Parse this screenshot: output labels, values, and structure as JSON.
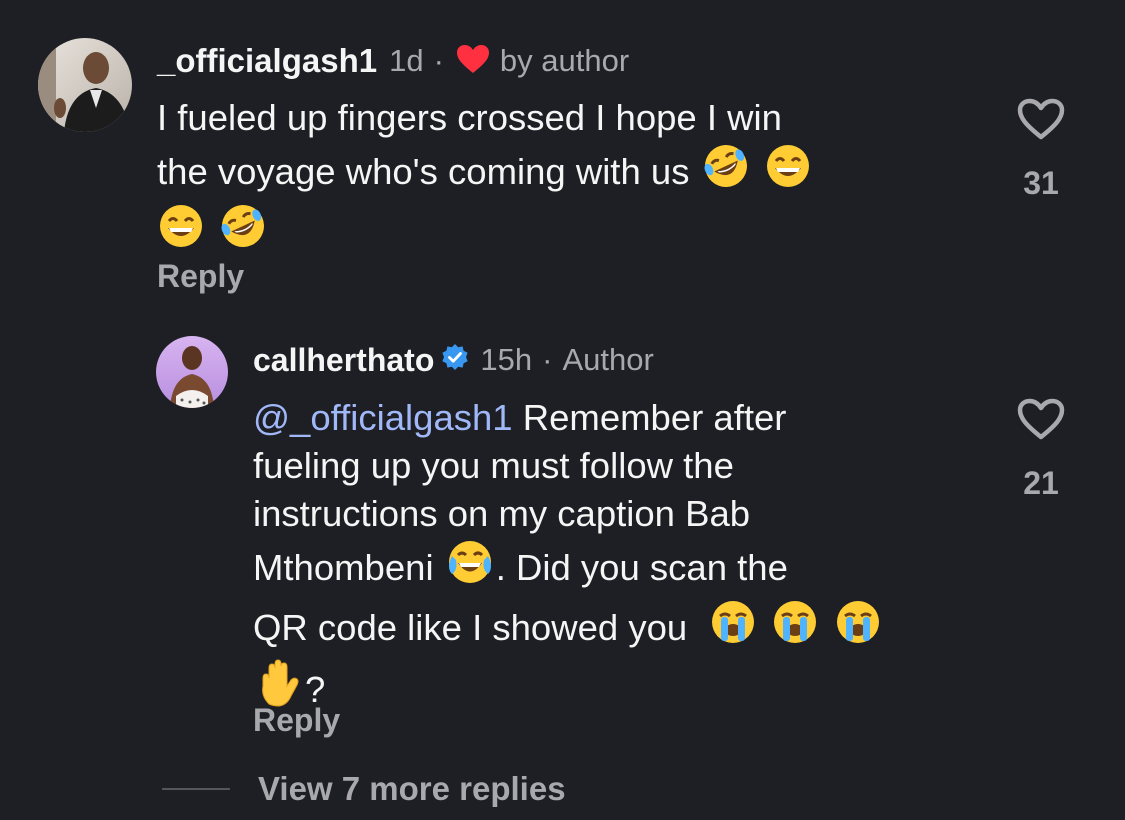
{
  "comment": {
    "username": "_officialgash1",
    "time": "1d",
    "separator": "·",
    "liked_by_author_label": "by author",
    "text_line1": "I fueled up fingers crossed I hope I win",
    "text_line2": "the voyage who's coming with us",
    "reply_label": "Reply",
    "like_count": "31",
    "icons": [
      "heart-icon",
      "rolling-laughing-emoji",
      "grinning-emoji"
    ]
  },
  "reply": {
    "username": "callherthato",
    "verified": true,
    "time": "15h",
    "separator": "·",
    "author_label": "Author",
    "mention": "@_officialgash1",
    "text_line1": " Remember after",
    "text_line2": "fueling up you must follow the",
    "text_line3": "instructions on my caption Bab",
    "text_line4a": "Mthombeni",
    "text_line4b": ". Did you scan the",
    "text_line5": "QR code like I showed you",
    "text_line6": "?",
    "reply_label": "Reply",
    "like_count": "21",
    "icons": [
      "verified-badge-icon",
      "tears-of-joy-emoji",
      "crying-emoji",
      "raised-hand-emoji"
    ]
  },
  "view_more": {
    "label": "View 7 more replies"
  },
  "colors": {
    "background": "#1e1f24",
    "text": "#f5f5f5",
    "muted": "#a8a8ad",
    "mention": "#a0b8f8",
    "heart": "#ff3040",
    "verified": "#3897f0"
  }
}
